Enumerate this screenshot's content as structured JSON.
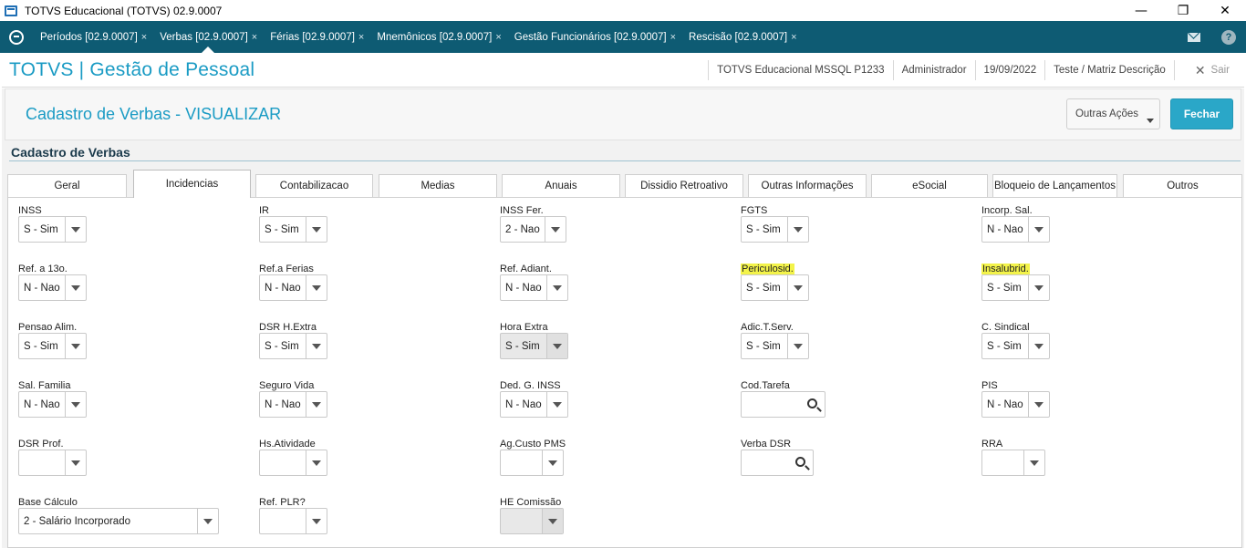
{
  "window": {
    "title": "TOTVS Educacional (TOTVS) 02.9.0007",
    "minimize": "—",
    "restore": "❐",
    "close": "✕"
  },
  "app_tabs": [
    {
      "label": "Períodos [02.9.0007]",
      "close": "×"
    },
    {
      "label": "Verbas [02.9.0007]",
      "close": "×",
      "active": true
    },
    {
      "label": "Férias [02.9.0007]",
      "close": "×"
    },
    {
      "label": "Mnemônicos [02.9.0007]",
      "close": "×"
    },
    {
      "label": "Gestão Funcionários [02.9.0007]",
      "close": "×"
    },
    {
      "label": "Rescisão [02.9.0007]",
      "close": "×"
    }
  ],
  "header": {
    "brand": "TOTVS | Gestão de Pessoal",
    "environment": "TOTVS Educacional MSSQL P1233",
    "user": "Administrador",
    "date": "19/09/2022",
    "company": "Teste / Matriz Descrição",
    "exit_icon": "✕",
    "exit_label": "Sair"
  },
  "page": {
    "title": "Cadastro de Verbas - VISUALIZAR",
    "actions_label": "Outras Ações",
    "close_label": "Fechar",
    "section_title": "Cadastro de Verbas"
  },
  "tabs": [
    "Geral",
    "Incidencias",
    "Contabilizacao",
    "Medias",
    "Anuais",
    "Dissidio Retroativo",
    "Outras Informações",
    "eSocial",
    "Bloqueio de Lançamentos",
    "Outros"
  ],
  "active_tab": "Incidencias",
  "fields": {
    "inss": {
      "label": "INSS",
      "value": "S - Sim"
    },
    "ir": {
      "label": "IR",
      "value": "S - Sim"
    },
    "inss_ferias": {
      "label": "INSS Fer.",
      "value": "2 - Nao"
    },
    "fgts": {
      "label": "FGTS",
      "value": "S - Sim"
    },
    "incorp_sal": {
      "label": "Incorp. Sal.",
      "value": "N - Nao"
    },
    "ref_13": {
      "label": "Ref. a 13o.",
      "value": "N - Nao"
    },
    "ref_ferias": {
      "label": "Ref.a Ferias",
      "value": "N - Nao"
    },
    "ref_adiant": {
      "label": "Ref. Adiant.",
      "value": "N - Nao"
    },
    "periculosid": {
      "label": "Periculosid.",
      "value": "S - Sim"
    },
    "insalubrid": {
      "label": "Insalubrid.",
      "value": "S - Sim"
    },
    "pensao_alim": {
      "label": "Pensao Alim.",
      "value": "S - Sim"
    },
    "dsr_hextra": {
      "label": "DSR H.Extra",
      "value": "S - Sim"
    },
    "hora_extra": {
      "label": "Hora Extra",
      "value": "S - Sim"
    },
    "adic_tserv": {
      "label": "Adic.T.Serv.",
      "value": "S - Sim"
    },
    "c_sindical": {
      "label": "C. Sindical",
      "value": "S - Sim"
    },
    "sal_familia": {
      "label": "Sal. Familia",
      "value": "N - Nao"
    },
    "seguro_vida": {
      "label": "Seguro Vida",
      "value": "N - Nao"
    },
    "ded_g_inss": {
      "label": "Ded. G. INSS",
      "value": "N - Nao"
    },
    "cod_tarefa": {
      "label": "Cod.Tarefa",
      "value": ""
    },
    "pis": {
      "label": "PIS",
      "value": "N - Nao"
    },
    "dsr_prof": {
      "label": "DSR Prof.",
      "value": ""
    },
    "hs_atividade": {
      "label": "Hs.Atividade",
      "value": ""
    },
    "ag_custo_pms": {
      "label": "Ag.Custo PMS",
      "value": ""
    },
    "verba_dsr": {
      "label": "Verba DSR",
      "value": ""
    },
    "rra": {
      "label": "RRA",
      "value": ""
    },
    "base_calculo": {
      "label": "Base Cálculo",
      "value": "2 - Salário Incorporado"
    },
    "ref_plr": {
      "label": "Ref. PLR?",
      "value": ""
    },
    "he_comissao": {
      "label": "HE Comissão",
      "value": ""
    }
  },
  "colors": {
    "tabstrip": "#0e5b73",
    "accent": "#1a9bc4",
    "primary_button": "#2aa7c8",
    "highlight": "#f3f34a"
  }
}
